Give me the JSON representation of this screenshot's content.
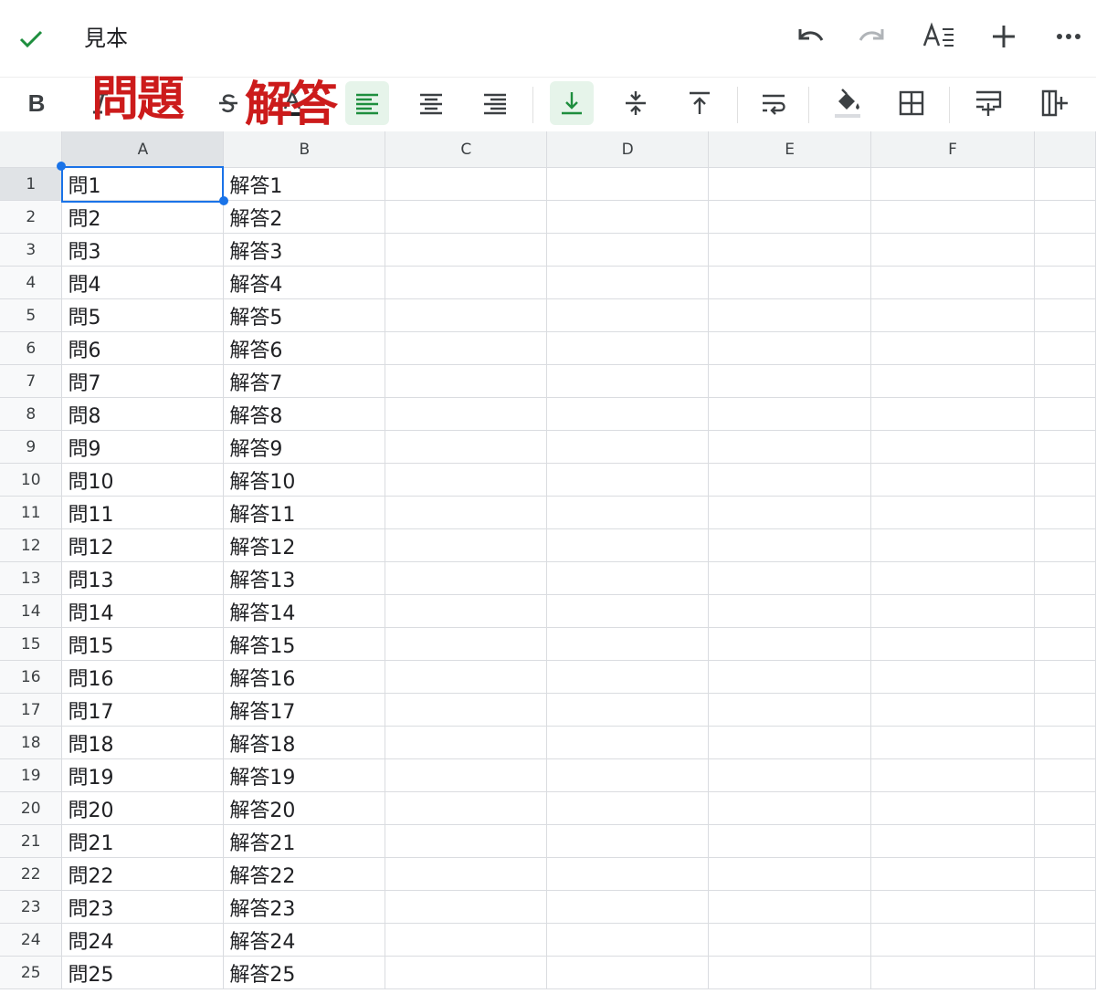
{
  "header": {
    "title": "見本",
    "icons": [
      "check-icon",
      "undo-icon",
      "redo-icon",
      "text-format-icon",
      "plus-icon",
      "more-icon"
    ]
  },
  "toolbar": {
    "bold_label": "B",
    "annotation_left": "問題",
    "annotation_right": "解答",
    "icons": [
      "bold-icon",
      "italic-icon",
      "strikethrough-icon",
      "text-color-icon",
      "align-left-icon",
      "align-center-icon",
      "align-right-icon",
      "valign-bottom-icon",
      "valign-middle-icon",
      "valign-top-icon",
      "wrap-text-icon",
      "fill-color-icon",
      "borders-icon",
      "insert-row-icon",
      "insert-column-icon"
    ],
    "active_color": "#1e8e3e"
  },
  "sheet": {
    "columns": [
      "A",
      "B",
      "C",
      "D",
      "E",
      "F"
    ],
    "selected_cell": "A1",
    "rows": [
      {
        "n": "1",
        "a": "問1",
        "b": "解答1"
      },
      {
        "n": "2",
        "a": "問2",
        "b": "解答2"
      },
      {
        "n": "3",
        "a": "問3",
        "b": "解答3"
      },
      {
        "n": "4",
        "a": "問4",
        "b": "解答4"
      },
      {
        "n": "5",
        "a": "問5",
        "b": "解答5"
      },
      {
        "n": "6",
        "a": "問6",
        "b": "解答6"
      },
      {
        "n": "7",
        "a": "問7",
        "b": "解答7"
      },
      {
        "n": "8",
        "a": "問8",
        "b": "解答8"
      },
      {
        "n": "9",
        "a": "問9",
        "b": "解答9"
      },
      {
        "n": "10",
        "a": "問10",
        "b": "解答10"
      },
      {
        "n": "11",
        "a": "問11",
        "b": "解答11"
      },
      {
        "n": "12",
        "a": "問12",
        "b": "解答12"
      },
      {
        "n": "13",
        "a": "問13",
        "b": "解答13"
      },
      {
        "n": "14",
        "a": "問14",
        "b": "解答14"
      },
      {
        "n": "15",
        "a": "問15",
        "b": "解答15"
      },
      {
        "n": "16",
        "a": "問16",
        "b": "解答16"
      },
      {
        "n": "17",
        "a": "問17",
        "b": "解答17"
      },
      {
        "n": "18",
        "a": "問18",
        "b": "解答18"
      },
      {
        "n": "19",
        "a": "問19",
        "b": "解答19"
      },
      {
        "n": "20",
        "a": "問20",
        "b": "解答20"
      },
      {
        "n": "21",
        "a": "問21",
        "b": "解答21"
      },
      {
        "n": "22",
        "a": "問22",
        "b": "解答22"
      },
      {
        "n": "23",
        "a": "問23",
        "b": "解答23"
      },
      {
        "n": "24",
        "a": "問24",
        "b": "解答24"
      },
      {
        "n": "25",
        "a": "問25",
        "b": "解答25"
      }
    ]
  }
}
